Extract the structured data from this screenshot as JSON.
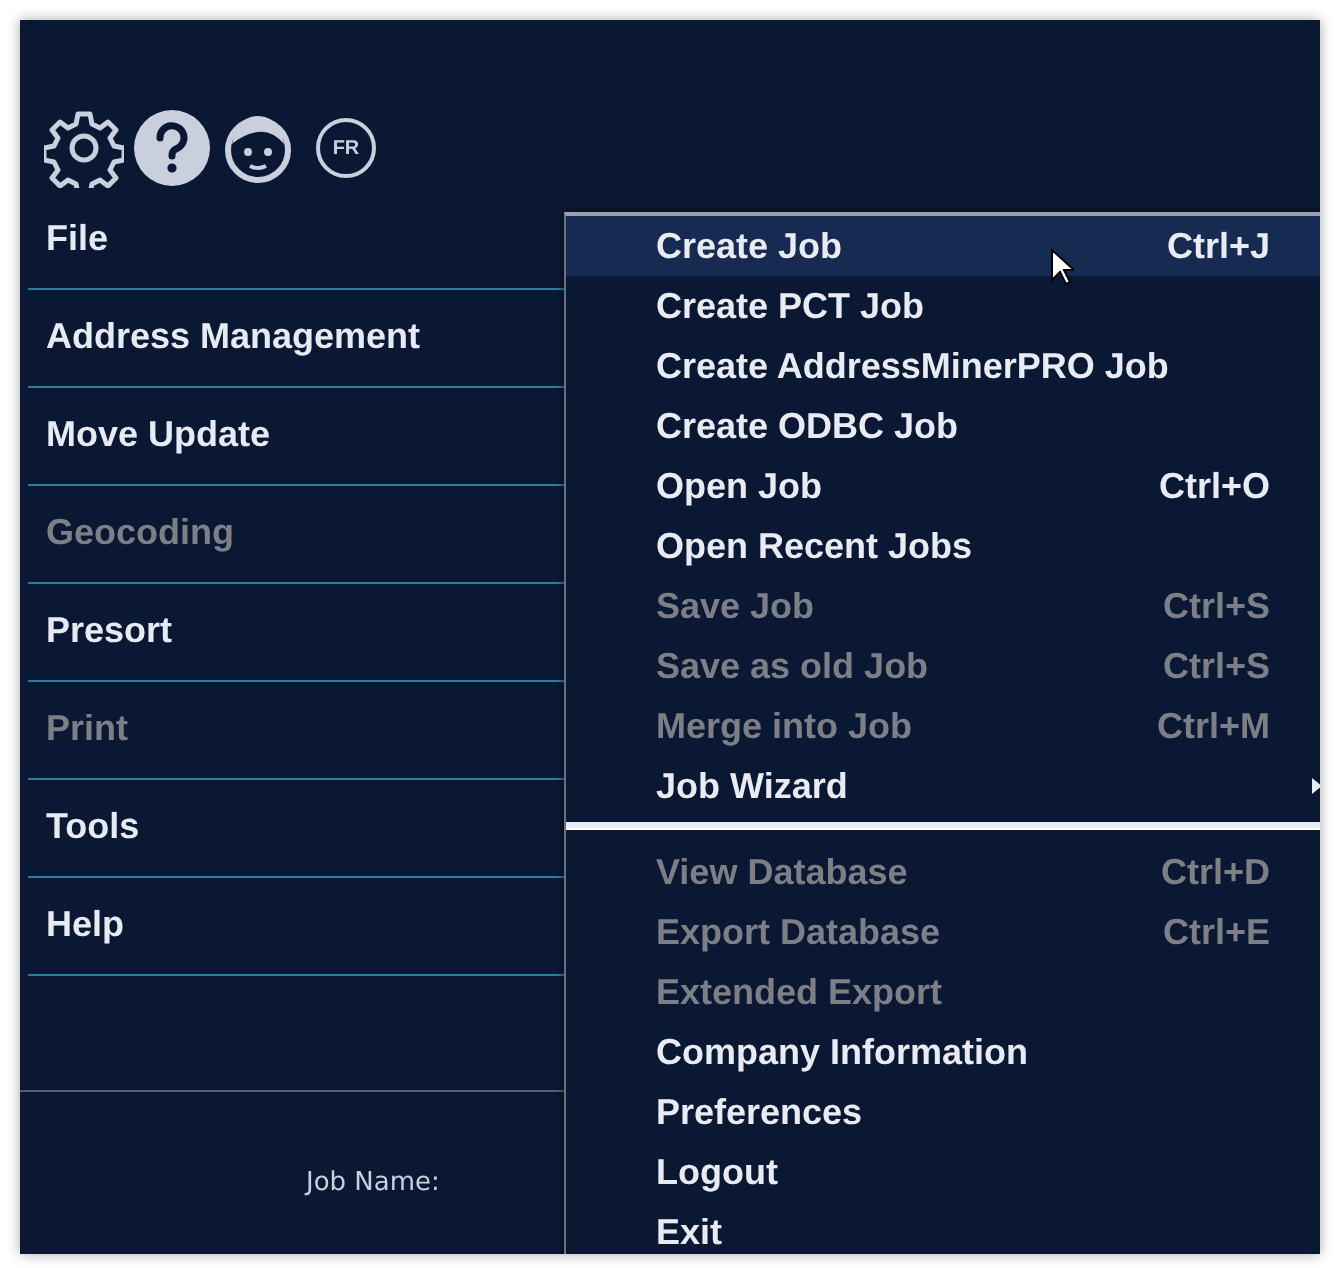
{
  "toolbar": {
    "language_badge": "FR"
  },
  "sidebar": {
    "items": [
      {
        "label": "File",
        "disabled": false
      },
      {
        "label": "Address Management",
        "disabled": false
      },
      {
        "label": "Move Update",
        "disabled": false
      },
      {
        "label": "Geocoding",
        "disabled": true
      },
      {
        "label": "Presort",
        "disabled": false
      },
      {
        "label": "Print",
        "disabled": true
      },
      {
        "label": "Tools",
        "disabled": false
      },
      {
        "label": "Help",
        "disabled": false
      }
    ]
  },
  "job_info": {
    "label": "Job Name:"
  },
  "menu": {
    "items": [
      {
        "kind": "item",
        "label": "Create Job",
        "shortcut": "Ctrl+J",
        "disabled": false,
        "selected": true,
        "submenu": false
      },
      {
        "kind": "item",
        "label": "Create PCT Job",
        "disabled": false,
        "selected": false,
        "submenu": false
      },
      {
        "kind": "item",
        "label": "Create AddressMinerPRO Job",
        "disabled": false,
        "selected": false,
        "submenu": false
      },
      {
        "kind": "item",
        "label": "Create ODBC Job",
        "disabled": false,
        "selected": false,
        "submenu": false
      },
      {
        "kind": "item",
        "label": "Open Job",
        "shortcut": "Ctrl+O",
        "disabled": false,
        "selected": false,
        "submenu": false
      },
      {
        "kind": "item",
        "label": "Open Recent Jobs",
        "disabled": false,
        "selected": false,
        "submenu": false
      },
      {
        "kind": "item",
        "label": "Save Job",
        "shortcut": "Ctrl+S",
        "disabled": true,
        "selected": false,
        "submenu": false
      },
      {
        "kind": "item",
        "label": "Save as old Job",
        "shortcut": "Ctrl+S",
        "disabled": true,
        "selected": false,
        "submenu": false
      },
      {
        "kind": "item",
        "label": "Merge into Job",
        "shortcut": "Ctrl+M",
        "disabled": true,
        "selected": false,
        "submenu": false
      },
      {
        "kind": "item",
        "label": "Job Wizard",
        "disabled": false,
        "selected": false,
        "submenu": true
      },
      {
        "kind": "separator"
      },
      {
        "kind": "item",
        "label": "View Database",
        "shortcut": "Ctrl+D",
        "disabled": true,
        "selected": false,
        "submenu": false
      },
      {
        "kind": "item",
        "label": "Export Database",
        "shortcut": "Ctrl+E",
        "disabled": true,
        "selected": false,
        "submenu": false
      },
      {
        "kind": "item",
        "label": "Extended Export",
        "disabled": true,
        "selected": false,
        "submenu": false
      },
      {
        "kind": "item",
        "label": "Company Information",
        "disabled": false,
        "selected": false,
        "submenu": false
      },
      {
        "kind": "item",
        "label": "Preferences",
        "disabled": false,
        "selected": false,
        "submenu": false
      },
      {
        "kind": "item",
        "label": "Logout",
        "disabled": false,
        "selected": false,
        "submenu": false
      },
      {
        "kind": "item",
        "label": "Exit",
        "disabled": false,
        "selected": false,
        "submenu": false
      }
    ]
  }
}
